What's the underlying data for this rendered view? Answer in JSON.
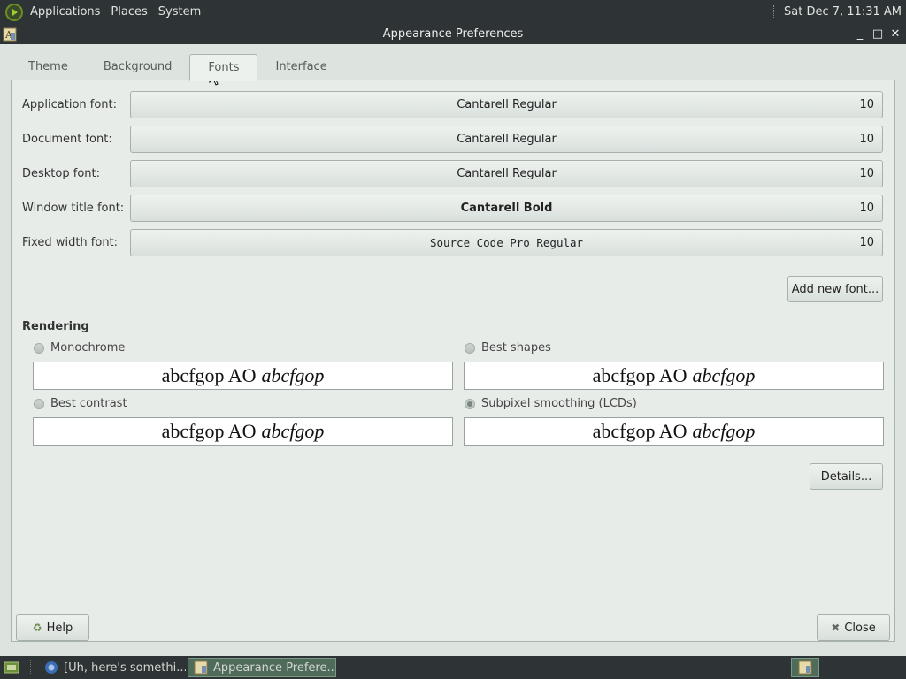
{
  "top_panel": {
    "menus": [
      "Applications",
      "Places",
      "System"
    ],
    "clock": "Sat Dec 7, 11:31 AM"
  },
  "titlebar": {
    "title": "Appearance Preferences",
    "minimize": "_",
    "maximize": "□",
    "close": "✕"
  },
  "tabs": [
    "Theme",
    "Background",
    "Fonts",
    "Interface"
  ],
  "active_tab": "Fonts",
  "fonts": [
    {
      "label": "Application font:",
      "font": "Cantarell Regular",
      "size": "10"
    },
    {
      "label": "Document font:",
      "font": "Cantarell Regular",
      "size": "10"
    },
    {
      "label": "Desktop font:",
      "font": "Cantarell Regular",
      "size": "10"
    },
    {
      "label": "Window title font:",
      "font": "Cantarell Bold",
      "size": "10"
    },
    {
      "label": "Fixed width font:",
      "font": "Source Code Pro Regular",
      "size": "10"
    }
  ],
  "add_font_label": "Add new font...",
  "rendering": {
    "title": "Rendering",
    "preview_regular": "abcfgop AO",
    "preview_italic": "abcfgop",
    "options": [
      {
        "label": "Monochrome",
        "selected": false
      },
      {
        "label": "Best shapes",
        "selected": false
      },
      {
        "label": "Best contrast",
        "selected": false
      },
      {
        "label": "Subpixel smoothing (LCDs)",
        "selected": true
      }
    ]
  },
  "details_label": "Details...",
  "help_label": "Help",
  "close_label": "Close",
  "taskbar": {
    "items": [
      "[Uh, here's somethi...",
      "Appearance Prefere..."
    ]
  },
  "colors": {
    "panel": "#2e3436",
    "window_bg": "#dde4df",
    "accent": "#4f6b5a"
  }
}
